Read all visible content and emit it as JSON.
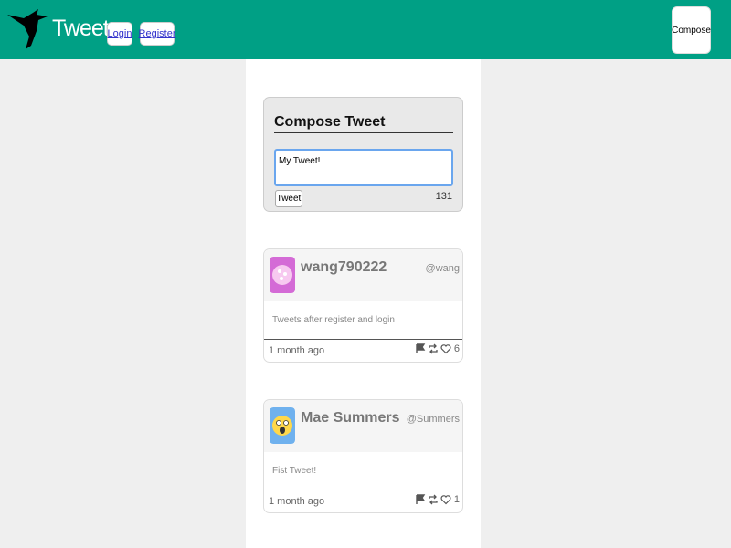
{
  "header": {
    "brand": "Tweeter",
    "logo_icon": "hummingbird-icon",
    "nav": {
      "login": "Login",
      "register": "Register"
    },
    "compose_label": "Compose",
    "accent_color": "#00a085"
  },
  "compose": {
    "title": "Compose Tweet",
    "input_value": "My Tweet!",
    "submit_label": "Tweet",
    "char_count": "131"
  },
  "tweets": [
    {
      "username": "wang790222",
      "handle": "@wang",
      "text": "Tweets after register and login",
      "time": "1 month ago",
      "likes": "6",
      "avatar_icon": "pink-cookie-avatar"
    },
    {
      "username": "Mae Summers",
      "handle": "@Summers",
      "text": "Fist Tweet!",
      "time": "1 month ago",
      "likes": "1",
      "avatar_icon": "surprised-face-avatar"
    }
  ]
}
